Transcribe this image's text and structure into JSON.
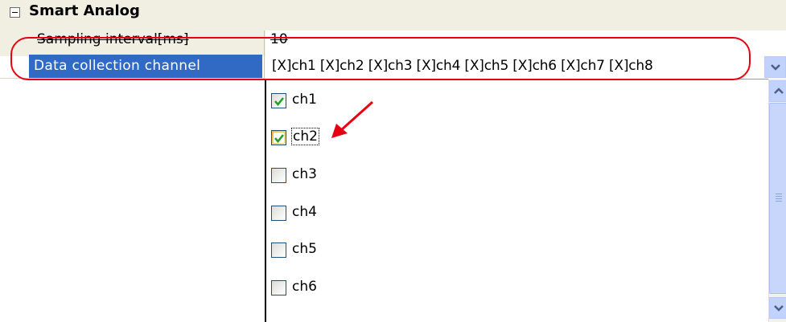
{
  "category": {
    "title": "Smart Analog",
    "collapse_symbol": "minus"
  },
  "properties": [
    {
      "name": "Sampling interval[ms]",
      "value": "10"
    },
    {
      "name": "Data collection channel",
      "value": "[X]ch1 [X]ch2 [X]ch3 [X]ch4 [X]ch5 [X]ch6 [X]ch7 [X]ch8"
    }
  ],
  "dropdown": {
    "options": [
      {
        "label": "ch1",
        "checked": true
      },
      {
        "label": "ch2",
        "checked": true
      },
      {
        "label": "ch3",
        "checked": false
      },
      {
        "label": "ch4",
        "checked": false
      },
      {
        "label": "ch5",
        "checked": false
      },
      {
        "label": "ch6",
        "checked": false
      }
    ]
  },
  "colors": {
    "selection": "#316ac5",
    "annotation": "#e60012",
    "check": "#21a121"
  },
  "icons": [
    "collapse-icon",
    "dropdown-arrow-icon",
    "scroll-up-icon",
    "scroll-down-icon",
    "checkmark-icon",
    "red-arrow-icon"
  ]
}
